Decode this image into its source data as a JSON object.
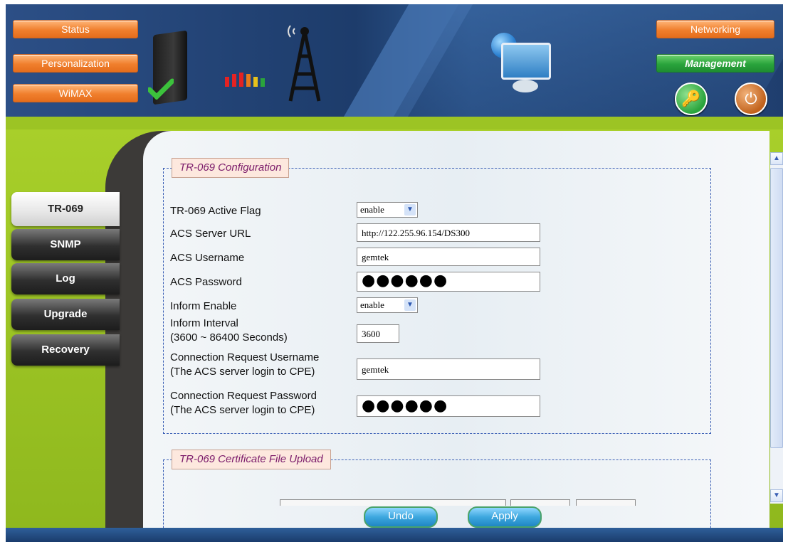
{
  "nav": {
    "status": "Status",
    "personalization": "Personalization",
    "wimax": "WiMAX",
    "networking": "Networking",
    "management": "Management"
  },
  "sidebar": {
    "items": [
      {
        "label": "TR-069",
        "active": true
      },
      {
        "label": "SNMP",
        "active": false
      },
      {
        "label": "Log",
        "active": false
      },
      {
        "label": "Upgrade",
        "active": false
      },
      {
        "label": "Recovery",
        "active": false
      }
    ]
  },
  "config": {
    "legend": "TR-069 Configuration",
    "active_flag_label": "TR-069 Active Flag",
    "active_flag_value": "enable",
    "acs_url_label": "ACS Server URL",
    "acs_url_value": "http://122.255.96.154/DS300",
    "acs_username_label": "ACS Username",
    "acs_username_value": "gemtek",
    "acs_password_label": "ACS Password",
    "acs_password_value": "●●●●●●",
    "inform_enable_label": "Inform Enable",
    "inform_enable_value": "enable",
    "inform_interval_label": "Inform Interval",
    "inform_interval_range": "(3600 ~ 86400 Seconds)",
    "inform_interval_value": "3600",
    "conn_user_label": "Connection Request Username",
    "conn_user_note": "(The ACS server login to CPE)",
    "conn_user_value": "gemtek",
    "conn_pass_label": "Connection Request Password",
    "conn_pass_note": "(The ACS server login to CPE)",
    "conn_pass_value": "●●●●●●"
  },
  "certificate": {
    "legend": "TR-069 Certificate File Upload"
  },
  "buttons": {
    "undo": "Undo",
    "apply": "Apply"
  },
  "icons": {
    "key": "key-icon",
    "power": "power-icon"
  },
  "colors": {
    "nav_orange": "#f07f2d",
    "nav_green": "#2aa43c",
    "lime": "#9cc424",
    "header_blue": "#1d3c6b"
  }
}
